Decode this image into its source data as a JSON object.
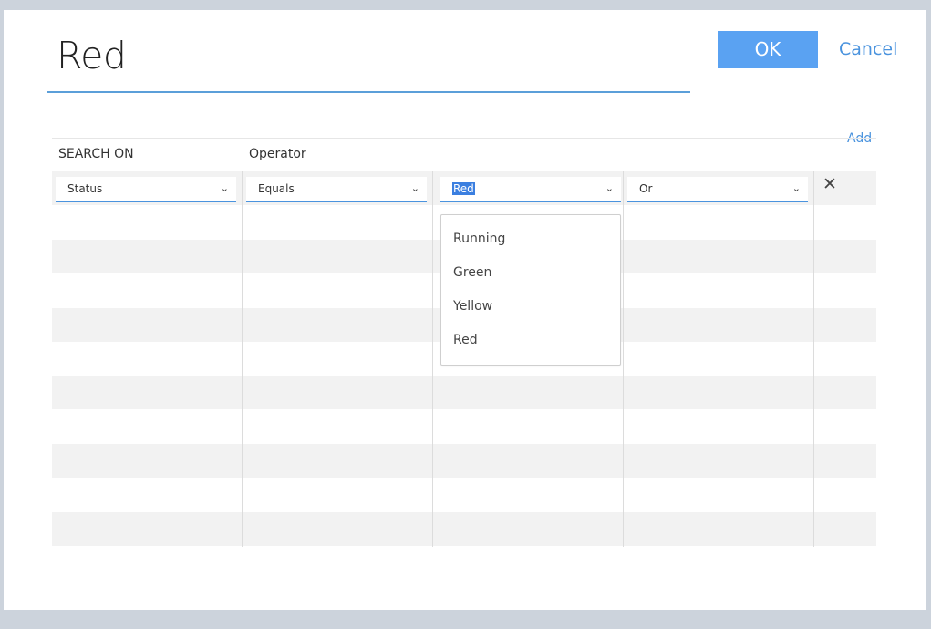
{
  "dialog": {
    "title": "Red",
    "ok_label": "OK",
    "cancel_label": "Cancel",
    "add_label": "Add"
  },
  "columns": {
    "search_on": "SEARCH ON",
    "operator": "Operator"
  },
  "row": {
    "field_value": "Status",
    "operator_value": "Equals",
    "value_value": "Red",
    "conjunction_value": "Or"
  },
  "dropdown": {
    "options": [
      "Running",
      "Green",
      "Yellow",
      "Red"
    ]
  },
  "icons": {
    "chevron": "chevron-down-icon",
    "remove": "close-icon"
  },
  "colors": {
    "accent": "#5aa2f2",
    "link": "#4a93de",
    "stripe": "#f2f2f2",
    "backdrop": "#ccd3dc"
  }
}
